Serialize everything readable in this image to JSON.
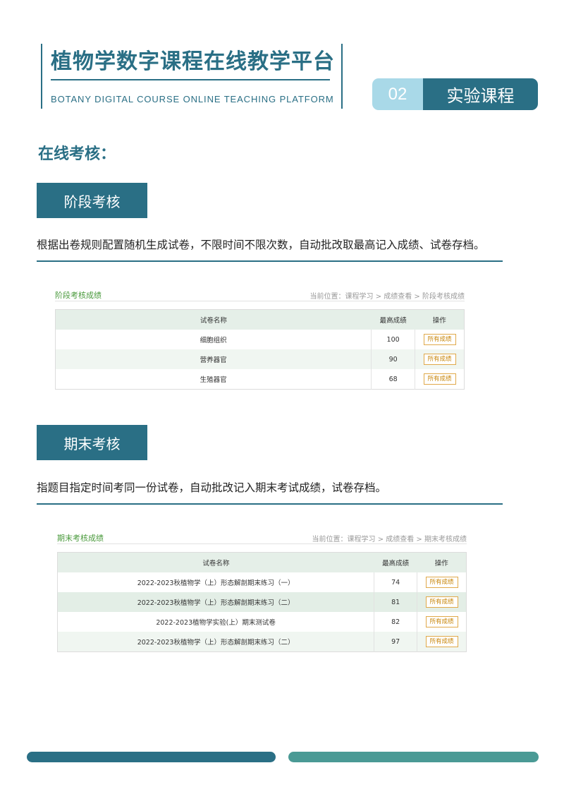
{
  "header": {
    "title": "植物学数字课程在线教学平台",
    "subtitle": "BOTANY DIGITAL COURSE ONLINE TEACHING PLATFORM",
    "tag_number": "02",
    "tag_label": "实验课程"
  },
  "section_title": "在线考核：",
  "stage": {
    "label": "阶段考核",
    "description": "根据出卷规则配置随机生成试卷，不限时间不限次数，自动批改取最高记入成绩、试卷存档。",
    "panel_title": "阶段考核成绩",
    "breadcrumb": "当前位置：课程学习 > 成绩查看 > 阶段考核成绩",
    "columns": [
      "试卷名称",
      "最高成绩",
      "操作"
    ],
    "rows": [
      {
        "name": "细胞组织",
        "score": "100",
        "action": "所有成绩"
      },
      {
        "name": "营养器官",
        "score": "90",
        "action": "所有成绩"
      },
      {
        "name": "生殖器官",
        "score": "68",
        "action": "所有成绩"
      }
    ]
  },
  "final": {
    "label": "期末考核",
    "description": "指题目指定时间考同一份试卷，自动批改记入期末考试成绩，试卷存档。",
    "panel_title": "期末考核成绩",
    "breadcrumb": "当前位置：课程学习 > 成绩查看 > 期末考核成绩",
    "columns": [
      "试卷名称",
      "最高成绩",
      "操作"
    ],
    "rows": [
      {
        "name": "2022-2023秋植物学（上）形态解剖期末练习（一）",
        "score": "74",
        "action": "所有成绩"
      },
      {
        "name": "2022-2023秋植物学（上）形态解剖期末练习（二）",
        "score": "81",
        "action": "所有成绩"
      },
      {
        "name": "2022-2023植物学实验(上）期末测试卷",
        "score": "82",
        "action": "所有成绩"
      },
      {
        "name": "2022-2023秋植物学（上）形态解剖期末练习（二）",
        "score": "97",
        "action": "所有成绩"
      }
    ]
  },
  "colors": {
    "primary": "#2a6f85",
    "light_blue": "#a9d9e8",
    "teal": "#4a9a95",
    "green_title": "#4a9a3c",
    "button_orange": "#c8860a"
  }
}
